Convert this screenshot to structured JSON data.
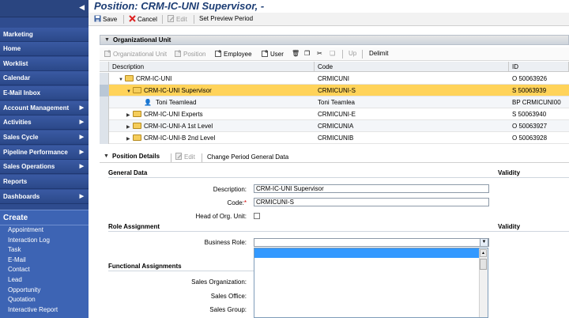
{
  "sidebar": {
    "nav_items": [
      {
        "label": "Marketing",
        "has_arrow": false
      },
      {
        "label": "Home",
        "has_arrow": false
      },
      {
        "label": "Worklist",
        "has_arrow": false
      },
      {
        "label": "Calendar",
        "has_arrow": false
      },
      {
        "label": "E-Mail Inbox",
        "has_arrow": false
      },
      {
        "label": "Account Management",
        "has_arrow": true
      },
      {
        "label": "Activities",
        "has_arrow": true
      },
      {
        "label": "Sales Cycle",
        "has_arrow": true
      },
      {
        "label": "Pipeline Performance",
        "has_arrow": true
      },
      {
        "label": "Sales Operations",
        "has_arrow": true
      },
      {
        "label": "Reports",
        "has_arrow": false
      },
      {
        "label": "Dashboards",
        "has_arrow": true
      }
    ],
    "create": {
      "title": "Create",
      "links": [
        "Appointment",
        "Interaction Log",
        "Task",
        "E-Mail",
        "Contact",
        "Lead",
        "Opportunity",
        "Quotation",
        "Interactive Report"
      ]
    }
  },
  "page": {
    "title": "Position: CRM-IC-UNI Supervisor, -"
  },
  "toolbar": {
    "save": "Save",
    "cancel": "Cancel",
    "edit": "Edit",
    "set_preview": "Set Preview Period"
  },
  "org_unit": {
    "header": "Organizational Unit",
    "toolbar": {
      "org_unit": "Organizational Unit",
      "position": "Position",
      "employee": "Employee",
      "user": "User",
      "up": "Up",
      "delimit": "Delimit"
    },
    "columns": [
      "Description",
      "Code",
      "ID"
    ],
    "rows": [
      {
        "description": "CRM-IC-UNI",
        "code": "CRMICUNI",
        "id": "O 50063926"
      },
      {
        "description": "CRM-IC-UNI Supervisor",
        "code": "CRMICUNI-S",
        "id": "S 50063939"
      },
      {
        "description": "Toni Teamlead",
        "code": "Toni Teamlea",
        "id": "BP CRMICUNI00"
      },
      {
        "description": "CRM-IC-UNI Experts",
        "code": "CRMICUNI-E",
        "id": "S 50063940"
      },
      {
        "description": "CRM-IC-UNI-A 1st Level",
        "code": "CRMICUNIA",
        "id": "O 50063927"
      },
      {
        "description": "CRM-IC-UNI-B 2nd Level",
        "code": "CRMICUNIB",
        "id": "O 50063928"
      }
    ]
  },
  "position_details": {
    "header": "Position Details",
    "edit": "Edit",
    "change_period": "Change Period General Data",
    "general_data": "General Data",
    "validity": "Validity",
    "description_label": "Description:",
    "description_value": "CRM-IC-UNI Supervisor",
    "code_label": "Code:",
    "code_required": "*",
    "code_value": "CRMICUNI-S",
    "head_label": "Head of Org. Unit:",
    "role_assignment": "Role Assignment",
    "business_role_label": "Business Role:",
    "functional_assignments": "Functional Assignments",
    "sales_org_label": "Sales Organization:",
    "sales_office_label": "Sales Office:",
    "sales_group_label": "Sales Group:"
  },
  "colors": {
    "sidebar_bg": "#2f4c8f",
    "title_blue": "#1c3d74",
    "selected_row": "#ffd35a",
    "dropdown_highlight": "#3399ff",
    "required": "#d00000"
  }
}
